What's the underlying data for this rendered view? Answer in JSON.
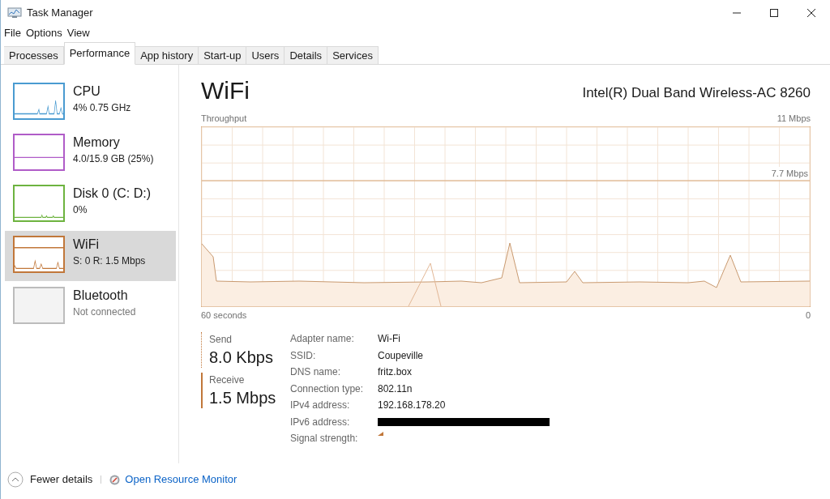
{
  "window": {
    "title": "Task Manager"
  },
  "menu": [
    "File",
    "Options",
    "View"
  ],
  "tabs": [
    {
      "label": "Processes",
      "selected": false
    },
    {
      "label": "Performance",
      "selected": true
    },
    {
      "label": "App history",
      "selected": false
    },
    {
      "label": "Start-up",
      "selected": false
    },
    {
      "label": "Users",
      "selected": false
    },
    {
      "label": "Details",
      "selected": false
    },
    {
      "label": "Services",
      "selected": false
    }
  ],
  "sidebar": {
    "items": [
      {
        "name": "CPU",
        "detail": "4%  0.75 GHz",
        "color": "#4a9bd1",
        "selected": false
      },
      {
        "name": "Memory",
        "detail": "4.0/15.9 GB (25%)",
        "color": "#b05cc8",
        "selected": false
      },
      {
        "name": "Disk 0 (C: D:)",
        "detail": "0%",
        "color": "#6db33f",
        "selected": false
      },
      {
        "name": "WiFi",
        "detail": "S: 0 R: 1.5 Mbps",
        "color": "#c1773a",
        "selected": true
      },
      {
        "name": "Bluetooth",
        "detail": "Not connected",
        "color": "#bcbcbc",
        "selected": false
      }
    ]
  },
  "main": {
    "title": "WiFi",
    "device": "Intel(R) Dual Band Wireless-AC 8260",
    "graph": {
      "label": "Throughput",
      "max_label": "11 Mbps",
      "mid_label": "7.7 Mbps",
      "time_label": "60 seconds",
      "min_label": "0"
    },
    "send": {
      "label": "Send",
      "value": "8.0 Kbps"
    },
    "receive": {
      "label": "Receive",
      "value": "1.5 Mbps"
    },
    "details": [
      {
        "kind": "text",
        "label": "Adapter name:",
        "value": "Wi-Fi"
      },
      {
        "kind": "text",
        "label": "SSID:",
        "value": "Coupeville"
      },
      {
        "kind": "text",
        "label": "DNS name:",
        "value": "fritz.box"
      },
      {
        "kind": "text",
        "label": "Connection type:",
        "value": "802.11n"
      },
      {
        "kind": "text",
        "label": "IPv4 address:",
        "value": "192.168.178.20"
      },
      {
        "kind": "redacted",
        "label": "IPv6 address:"
      },
      {
        "kind": "signal",
        "label": "Signal strength:"
      }
    ]
  },
  "footer": {
    "fewer_details": "Fewer details",
    "resource_monitor": "Open Resource Monitor"
  }
}
